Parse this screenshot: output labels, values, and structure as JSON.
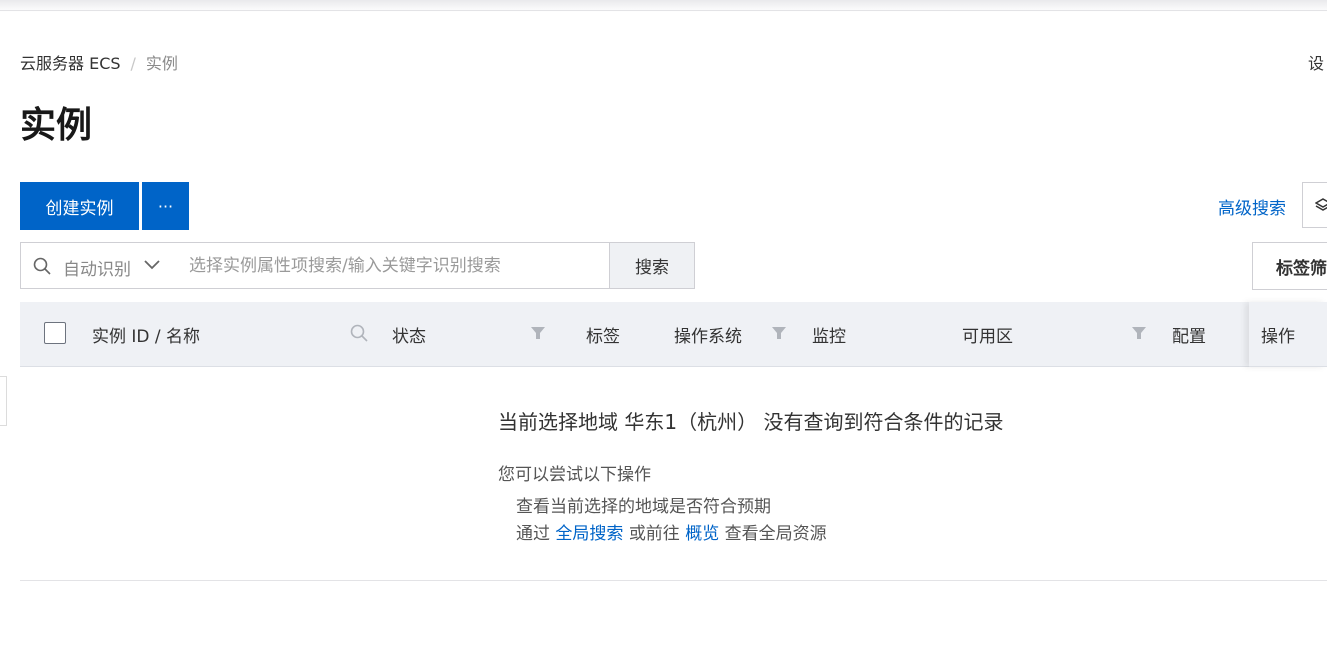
{
  "breadcrumb": {
    "root": "云服务器 ECS",
    "separator": "/",
    "current": "实例"
  },
  "header": {
    "settings_label": "设"
  },
  "page": {
    "title": "实例"
  },
  "toolbar": {
    "create_label": "创建实例",
    "more_label": "···",
    "advanced_search_label": "高级搜索",
    "tag_filter_label": "标签筛"
  },
  "search": {
    "mode_label": "自动识别",
    "placeholder": "选择实例属性项搜索/输入关键字识别搜索",
    "value": "",
    "button_label": "搜索"
  },
  "table": {
    "columns": [
      "实例 ID / 名称",
      "状态",
      "标签",
      "操作系统",
      "监控",
      "可用区",
      "配置",
      "操作"
    ]
  },
  "empty": {
    "title": "当前选择地域 华东1（杭州） 没有查询到符合条件的记录",
    "hint": "您可以尝试以下操作",
    "line1": "查看当前选择的地域是否符合预期",
    "line2_prefix": "通过",
    "line2_link1": "全局搜索",
    "line2_middle": "或前往",
    "line2_link2": "概览",
    "line2_suffix": "查看全局资源"
  },
  "colors": {
    "primary": "#0064c8",
    "header_bg": "#eff1f5"
  },
  "icons": [
    "search-icon",
    "chevron-down-icon",
    "layers-icon",
    "filter-icon",
    "more-icon"
  ]
}
